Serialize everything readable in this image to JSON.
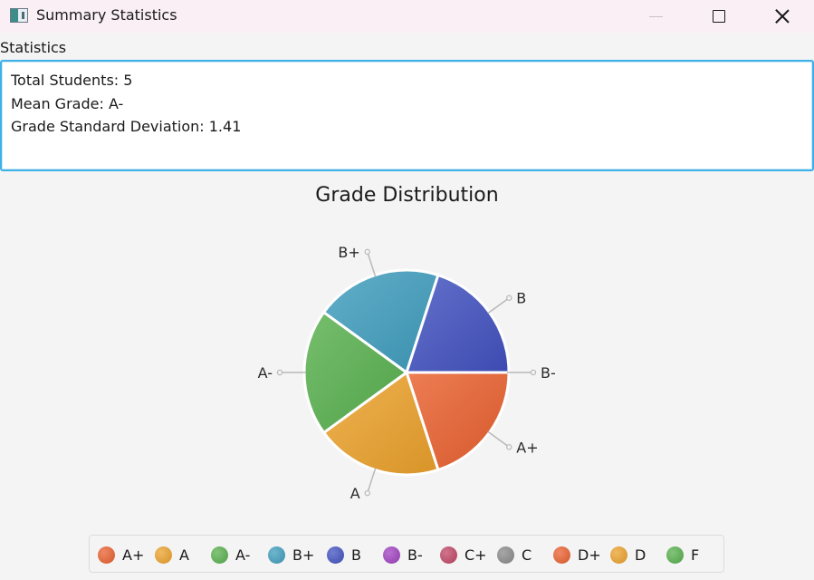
{
  "window": {
    "title": "Summary Statistics",
    "app_icon": "app-icon",
    "controls": [
      "minimize-icon",
      "maximize-icon",
      "close-icon"
    ]
  },
  "statistics": {
    "label": "Statistics",
    "lines": [
      "Total Students: 5",
      "Mean Grade: A-",
      "Grade Standard Deviation: 1.41"
    ]
  },
  "chart_data": {
    "type": "pie",
    "title": "Grade Distribution",
    "start_angle_deg": 0,
    "direction": "clockwise",
    "slices": [
      {
        "label": "A+",
        "value": 1,
        "color": "#e9602f"
      },
      {
        "label": "A",
        "value": 1,
        "color": "#eba12b"
      },
      {
        "label": "A-",
        "value": 1,
        "color": "#58b04e"
      },
      {
        "label": "B+",
        "value": 1,
        "color": "#3f9dbd"
      },
      {
        "label": "B",
        "value": 1,
        "color": "#4252c0"
      },
      {
        "label": "B-",
        "value": 0,
        "color": "#a040c0"
      }
    ],
    "legend_position": "bottom",
    "legend": [
      {
        "label": "A+",
        "color": "#e9602f"
      },
      {
        "label": "A",
        "color": "#eba12b"
      },
      {
        "label": "A-",
        "color": "#58b04e"
      },
      {
        "label": "B+",
        "color": "#3f9dbd"
      },
      {
        "label": "B",
        "color": "#4252c0"
      },
      {
        "label": "B-",
        "color": "#a040c0"
      },
      {
        "label": "C+",
        "color": "#c04565"
      },
      {
        "label": "C",
        "color": "#8a8a8a"
      },
      {
        "label": "D+",
        "color": "#e9602f"
      },
      {
        "label": "D",
        "color": "#eba12b"
      },
      {
        "label": "F",
        "color": "#58b04e"
      }
    ]
  }
}
